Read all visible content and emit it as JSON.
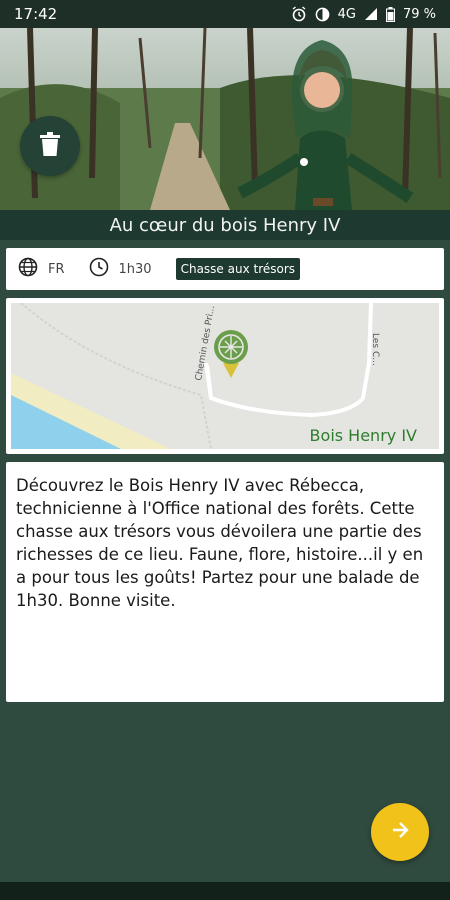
{
  "status_bar": {
    "time": "17:42",
    "network": "4G",
    "battery": "79 %"
  },
  "hero": {
    "image_description": "forest-path-with-guide-character"
  },
  "title": "Au cœur du bois Henry IV",
  "info": {
    "language": "FR",
    "duration": "1h30",
    "tag": "Chasse aux trésors"
  },
  "map": {
    "place_label": "Bois Henry IV",
    "road_labels": [
      "Chemin des Pri...",
      "Les C..."
    ]
  },
  "description": "Découvrez le Bois Henry IV avec Rébecca, technicienne à l'Office national des forêts. Cette chasse aux trésors vous dévoilera une partie des richesses de ce lieu. Faune, flore, histoire...il y en a pour tous les goûts! Partez pour une balade de 1h30. Bonne visite.",
  "colors": {
    "background": "#2f4a3f",
    "title_bar": "#1e3a30",
    "fab": "#f0c21a",
    "map_label": "#2e7d2e"
  }
}
